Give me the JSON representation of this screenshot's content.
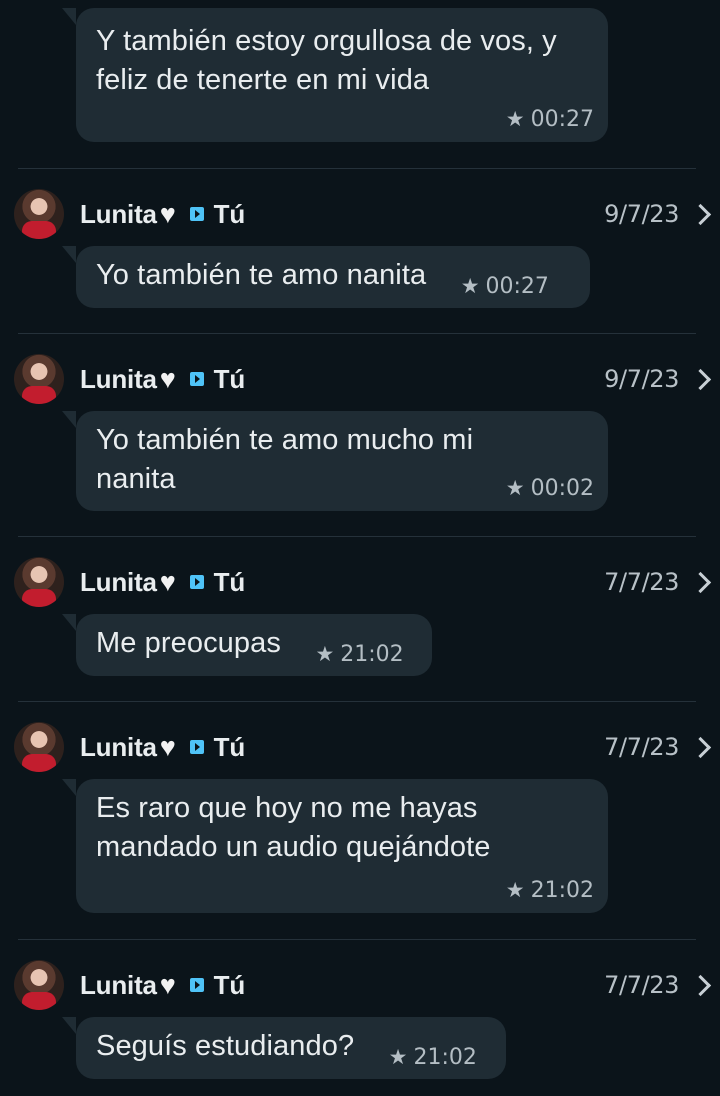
{
  "messages": [
    {
      "text": "Y también estoy orgullosa de vos, y feliz de tenerte en mi vida",
      "time": "00:27"
    },
    {
      "sender": "Lunita",
      "recipient": "Tú",
      "date": "9/7/23",
      "text": "Yo también te amo nanita",
      "time": "00:27"
    },
    {
      "sender": "Lunita",
      "recipient": "Tú",
      "date": "9/7/23",
      "text": "Yo también te amo mucho mi nanita",
      "time": "00:02"
    },
    {
      "sender": "Lunita",
      "recipient": "Tú",
      "date": "7/7/23",
      "text": "Me preocupas",
      "time": "21:02"
    },
    {
      "sender": "Lunita",
      "recipient": "Tú",
      "date": "7/7/23",
      "text": "Es raro que hoy no me hayas mandado un audio quejándote",
      "time": "21:02"
    },
    {
      "sender": "Lunita",
      "recipient": "Tú",
      "date": "7/7/23",
      "text": "Seguís estudiando?",
      "time": "21:02"
    }
  ],
  "icons": {
    "heart": "white-heart-icon",
    "forward": "forward-arrow-icon",
    "star": "star-icon",
    "chevron": "chevron-right-icon"
  },
  "colors": {
    "background": "#0b141a",
    "bubble": "#1f2c34",
    "text": "#e9edef",
    "meta": "#b4bec4",
    "accent": "#4fc3f7"
  }
}
